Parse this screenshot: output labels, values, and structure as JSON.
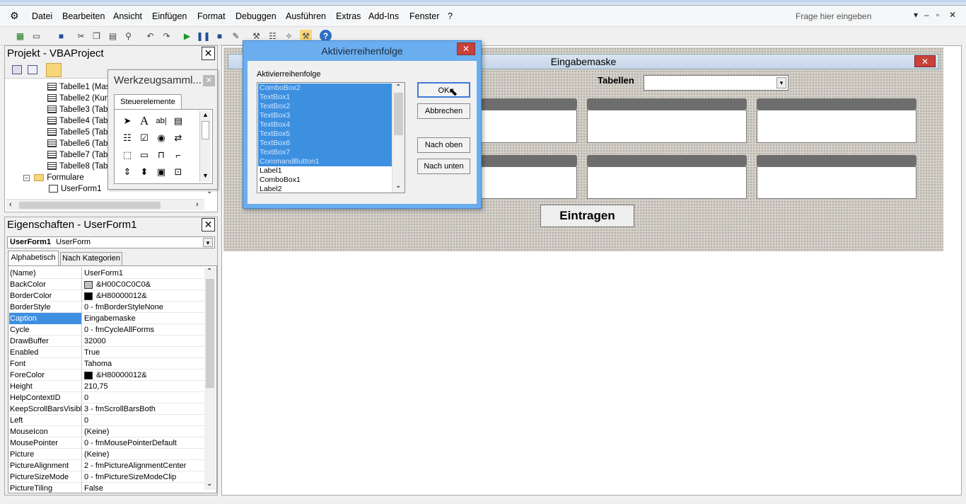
{
  "menu": {
    "items": [
      "Datei",
      "Bearbeiten",
      "Ansicht",
      "Einfügen",
      "Format",
      "Debuggen",
      "Ausführen",
      "Extras",
      "Add-Ins",
      "Fenster",
      "?"
    ],
    "help_placeholder": "Frage hier eingeben"
  },
  "project": {
    "title": "Projekt - VBAProject",
    "close": "✕",
    "sheets": [
      "Tabelle1 (Mas",
      "Tabelle2 (Kun",
      "Tabelle3 (Tab",
      "Tabelle4 (Tab",
      "Tabelle5 (Tab",
      "Tabelle6 (Tab",
      "Tabelle7 (Tab",
      "Tabelle8 (Tab"
    ],
    "folder": "Formulare",
    "form": "UserForm1"
  },
  "toolbox": {
    "title": "Werkzeugsamml...",
    "close": "✕",
    "tab": "Steuerelemente"
  },
  "properties": {
    "title": "Eigenschaften - UserForm1",
    "close": "✕",
    "object_name": "UserForm1",
    "object_type": "UserForm",
    "tab_alpha": "Alphabetisch",
    "tab_cat": "Nach Kategorien",
    "rows": [
      {
        "name": "(Name)",
        "value": "UserForm1"
      },
      {
        "name": "BackColor",
        "value": "&H00C0C0C0&",
        "swatch": "#c0c0c0"
      },
      {
        "name": "BorderColor",
        "value": "&H80000012&",
        "swatch": "#000000"
      },
      {
        "name": "BorderStyle",
        "value": "0 - fmBorderStyleNone"
      },
      {
        "name": "Caption",
        "value": "Eingabemaske",
        "selected": true
      },
      {
        "name": "Cycle",
        "value": "0 - fmCycleAllForms"
      },
      {
        "name": "DrawBuffer",
        "value": "32000"
      },
      {
        "name": "Enabled",
        "value": "True"
      },
      {
        "name": "Font",
        "value": "Tahoma"
      },
      {
        "name": "ForeColor",
        "value": "&H80000012&",
        "swatch": "#000000"
      },
      {
        "name": "Height",
        "value": "210,75"
      },
      {
        "name": "HelpContextID",
        "value": "0"
      },
      {
        "name": "KeepScrollBarsVisible",
        "value": "3 - fmScrollBarsBoth"
      },
      {
        "name": "Left",
        "value": "0"
      },
      {
        "name": "MouseIcon",
        "value": "(Keine)"
      },
      {
        "name": "MousePointer",
        "value": "0 - fmMousePointerDefault"
      },
      {
        "name": "Picture",
        "value": "(Keine)"
      },
      {
        "name": "PictureAlignment",
        "value": "2 - fmPictureAlignmentCenter"
      },
      {
        "name": "PictureSizeMode",
        "value": "0 - fmPictureSizeModeClip"
      },
      {
        "name": "PictureTiling",
        "value": "False"
      }
    ]
  },
  "form": {
    "caption": "Eingabemaske",
    "close": "✕",
    "label_tabellen": "Tabellen",
    "button": "Eintragen"
  },
  "dialog": {
    "title": "Aktivierreihenfolge",
    "close": "✕",
    "list_label": "Aktivierreihenfolge",
    "items": [
      {
        "label": "ComboBox2",
        "selected": true
      },
      {
        "label": "TextBox1",
        "selected": true
      },
      {
        "label": "TextBox2",
        "selected": true
      },
      {
        "label": "TextBox3",
        "selected": true
      },
      {
        "label": "TextBox4",
        "selected": true
      },
      {
        "label": "TextBox5",
        "selected": true
      },
      {
        "label": "TextBox6",
        "selected": true
      },
      {
        "label": "TextBox7",
        "selected": true
      },
      {
        "label": "CommandButton1",
        "selected": true
      },
      {
        "label": "Label1",
        "selected": false
      },
      {
        "label": "ComboBox1",
        "selected": false
      },
      {
        "label": "Label2",
        "selected": false
      }
    ],
    "ok": "OK",
    "cancel": "Abbrechen",
    "up": "Nach oben",
    "down": "Nach unten"
  },
  "colors": {
    "selection": "#3d8fe0",
    "dialog_frame": "#6aaef0",
    "close_red": "#c8413a"
  }
}
